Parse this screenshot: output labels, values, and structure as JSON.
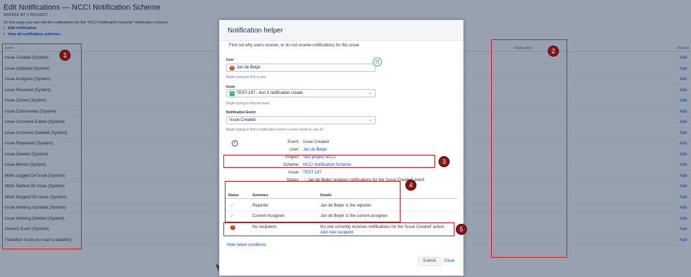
{
  "page": {
    "title": "Edit Notifications — NCCI Notification Scheme",
    "shared": "SHARED BY 1 PROJECT",
    "description": "On this page you can edit the notifications for the \"NCCI Notification Scheme\" notification scheme.",
    "links": [
      "Add notification",
      "View all notification schemes"
    ]
  },
  "table": {
    "headers": {
      "event": "Event",
      "notifications": "Notifications",
      "actions": "Actions"
    },
    "add_label": "Add",
    "events": [
      "Issue Created (System)",
      "Issue Updated (System)",
      "Issue Assigned (System)",
      "Issue Resolved (System)",
      "Issue Closed (System)",
      "Issue Commented (System)",
      "Issue Comment Edited (System)",
      "Issue Comment Deleted (System)",
      "Issue Reopened (System)",
      "Issue Deleted (System)",
      "Issue Moved (System)",
      "Work Logged On Issue (System)",
      "Work Started On Issue (System)",
      "Work Stopped On Issue (System)",
      "Issue Worklog Updated (System)",
      "Issue Worklog Deleted (System)",
      "Generic Event (System)",
      "Transition Issue (no mail to watcher)"
    ]
  },
  "dialog": {
    "title": "Notification helper",
    "subtitle": "Find out why users receive, or do not receive notifications for this issue",
    "user_label": "User",
    "user_value": "Jan de Beijer",
    "user_hint": "Begin typing to find a user",
    "issue_label": "Issue",
    "issue_value": "TEST-197 - test 3 notification create",
    "issue_hint": "Begin typing to find an issue",
    "event_label": "Notification Event",
    "event_value": "Issue Created",
    "event_hint": "Begin typing to find a notification event or press down to see all",
    "details": {
      "event_key": "Event:",
      "event_val": "Issue Created",
      "user_key": "User:",
      "user_val": "Jan de Beijer",
      "project_key": "Project:",
      "project_val": "Test project NCCI",
      "scheme_key": "Scheme:",
      "scheme_val": "NCCI Notification Scheme",
      "issue_key": "Issue:",
      "issue_val": "TEST-197",
      "status_key": "Status:",
      "status_val": "Jan de Beijer receives notifications for the 'Issue Created' event"
    },
    "results": {
      "headers": {
        "status": "Status",
        "summary": "Summary",
        "details": "Details"
      },
      "rows": [
        {
          "summary": "Reporter",
          "details": "Jan de Beijer is the reporter"
        },
        {
          "summary": "Current Assignee",
          "details": "Jan de Beijer is the current assignee"
        }
      ],
      "failed": {
        "summary": "No recipients",
        "details": "No one currently receives notifications for the 'Issue Created' action.",
        "link": "Add new recipient."
      }
    },
    "hide_failed": "Hide failed conditions",
    "submit": "Submit",
    "close": "Close"
  },
  "annotations": [
    "1",
    "2",
    "3",
    "4",
    "5"
  ],
  "colors": {
    "annotation": "#d6161c",
    "badge": "#8b1414",
    "link": "#0052cc",
    "success": "#36b37e",
    "error": "#de350b"
  }
}
